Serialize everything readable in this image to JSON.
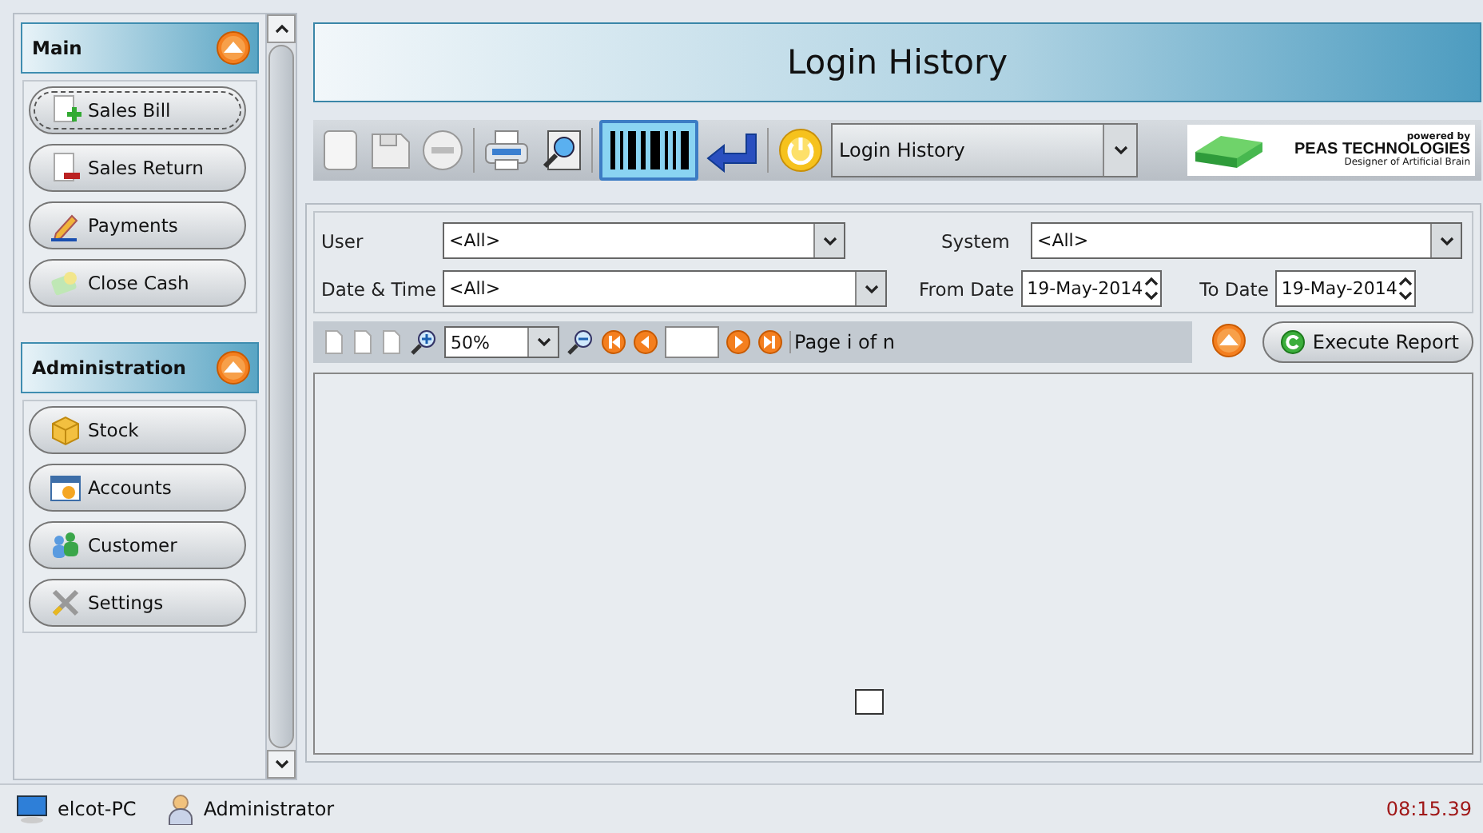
{
  "sidebar": {
    "sections": [
      {
        "title": "Main",
        "expanded": true,
        "items": [
          {
            "label": "Sales Bill",
            "focused": true
          },
          {
            "label": "Sales Return",
            "focused": false
          },
          {
            "label": "Payments",
            "focused": false
          },
          {
            "label": "Close Cash",
            "focused": false
          }
        ]
      },
      {
        "title": "Administration",
        "expanded": true,
        "items": [
          {
            "label": "Stock",
            "focused": false
          },
          {
            "label": "Accounts",
            "focused": false
          },
          {
            "label": "Customer",
            "focused": false
          },
          {
            "label": "Settings",
            "focused": false
          }
        ]
      }
    ]
  },
  "header": {
    "title": "Login History"
  },
  "toolbar": {
    "tools": [
      {
        "kind": "new",
        "selected": false
      },
      {
        "kind": "save",
        "selected": false
      },
      {
        "kind": "delete",
        "selected": false
      },
      {
        "kind": "print",
        "selected": false
      },
      {
        "kind": "preview",
        "selected": false
      },
      {
        "kind": "barcode",
        "selected": true
      },
      {
        "kind": "enter",
        "selected": false
      },
      {
        "kind": "power",
        "selected": false
      }
    ],
    "report_select": {
      "value": "Login History"
    },
    "logo": {
      "powered": "powered by",
      "name": "PEAS TECHNOLOGIES",
      "tagline": "Designer of Artificial Brain"
    }
  },
  "filters": {
    "user": {
      "label": "User",
      "value": "<All>"
    },
    "system": {
      "label": "System",
      "value": "<All>"
    },
    "date_time": {
      "label": "Date & Time",
      "value": "<All>"
    },
    "from_date": {
      "label": "From Date",
      "value": "19-May-2014"
    },
    "to_date": {
      "label": "To Date",
      "value": "19-May-2014"
    }
  },
  "report_bar": {
    "zoom": "50%",
    "page_text": "Page i of n",
    "execute": "Execute Report"
  },
  "status_bar": {
    "computer": "elcot-PC",
    "user": "Administrator",
    "time": "08:15.39"
  }
}
